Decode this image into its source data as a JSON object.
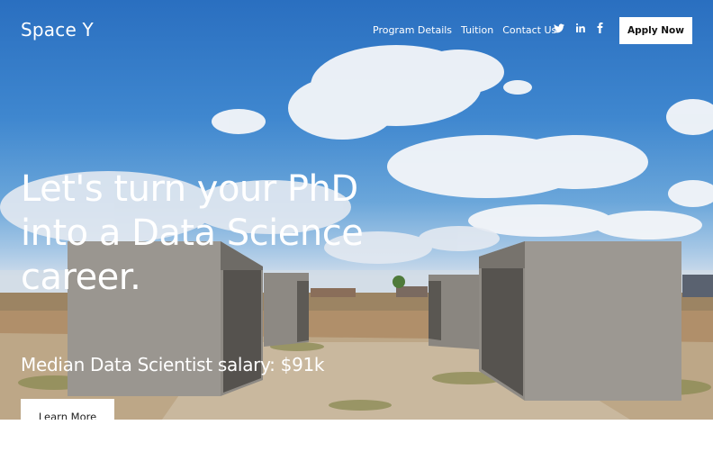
{
  "brand": {
    "name": "Space Y"
  },
  "nav": {
    "links": [
      "Program Details",
      "Tuition",
      "Contact Us"
    ]
  },
  "social": {
    "icons": [
      "twitter-icon",
      "linkedin-icon",
      "facebook-icon"
    ]
  },
  "header": {
    "apply_label": "Apply Now"
  },
  "hero": {
    "headline": "Let's turn your PhD into a Data Science career.",
    "subline": "Median Data Scientist salary: $91k",
    "cta_label": "Learn More"
  },
  "colors": {
    "sky": "#3f87cf",
    "text": "#ffffff",
    "button_bg": "#ffffff"
  }
}
